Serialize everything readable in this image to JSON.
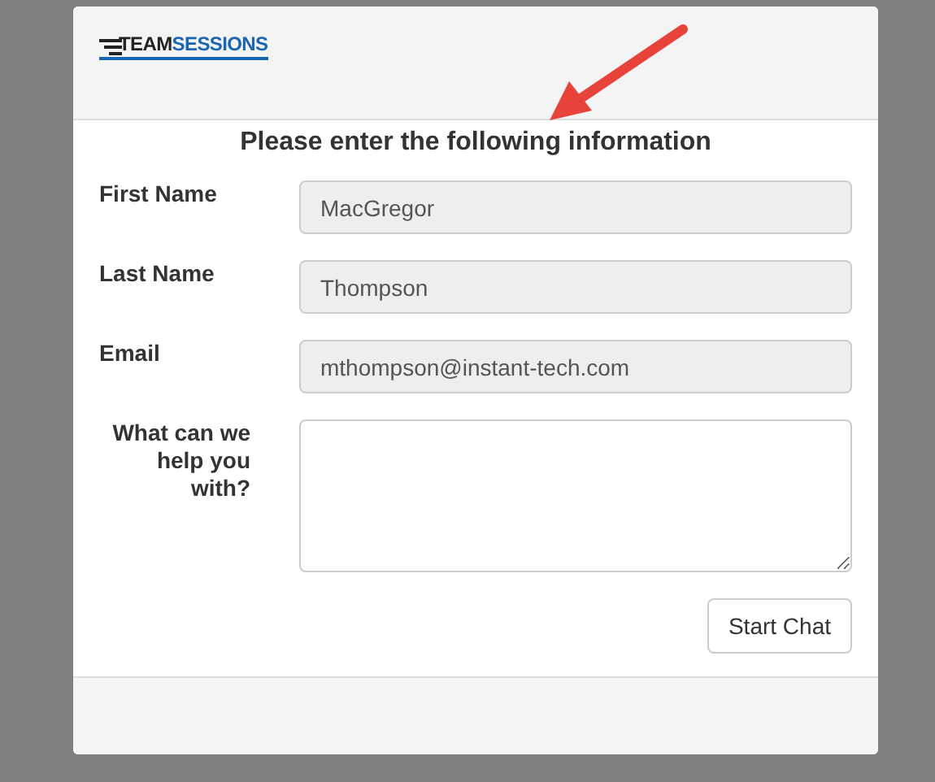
{
  "logo": {
    "parts": [
      "TEAM",
      "SESSIONS"
    ]
  },
  "heading": "Please enter the following information",
  "fields": [
    {
      "kind": "text",
      "label": "First Name",
      "value": "MacGregor",
      "disabled": true
    },
    {
      "kind": "text",
      "label": "Last Name",
      "value": "Thompson",
      "disabled": true
    },
    {
      "kind": "text",
      "label": "Email",
      "value": "mthompson@instant-tech.com",
      "disabled": true
    },
    {
      "kind": "textarea",
      "label": "What can we help you with?",
      "disabled": false
    }
  ],
  "button": "Start Chat"
}
